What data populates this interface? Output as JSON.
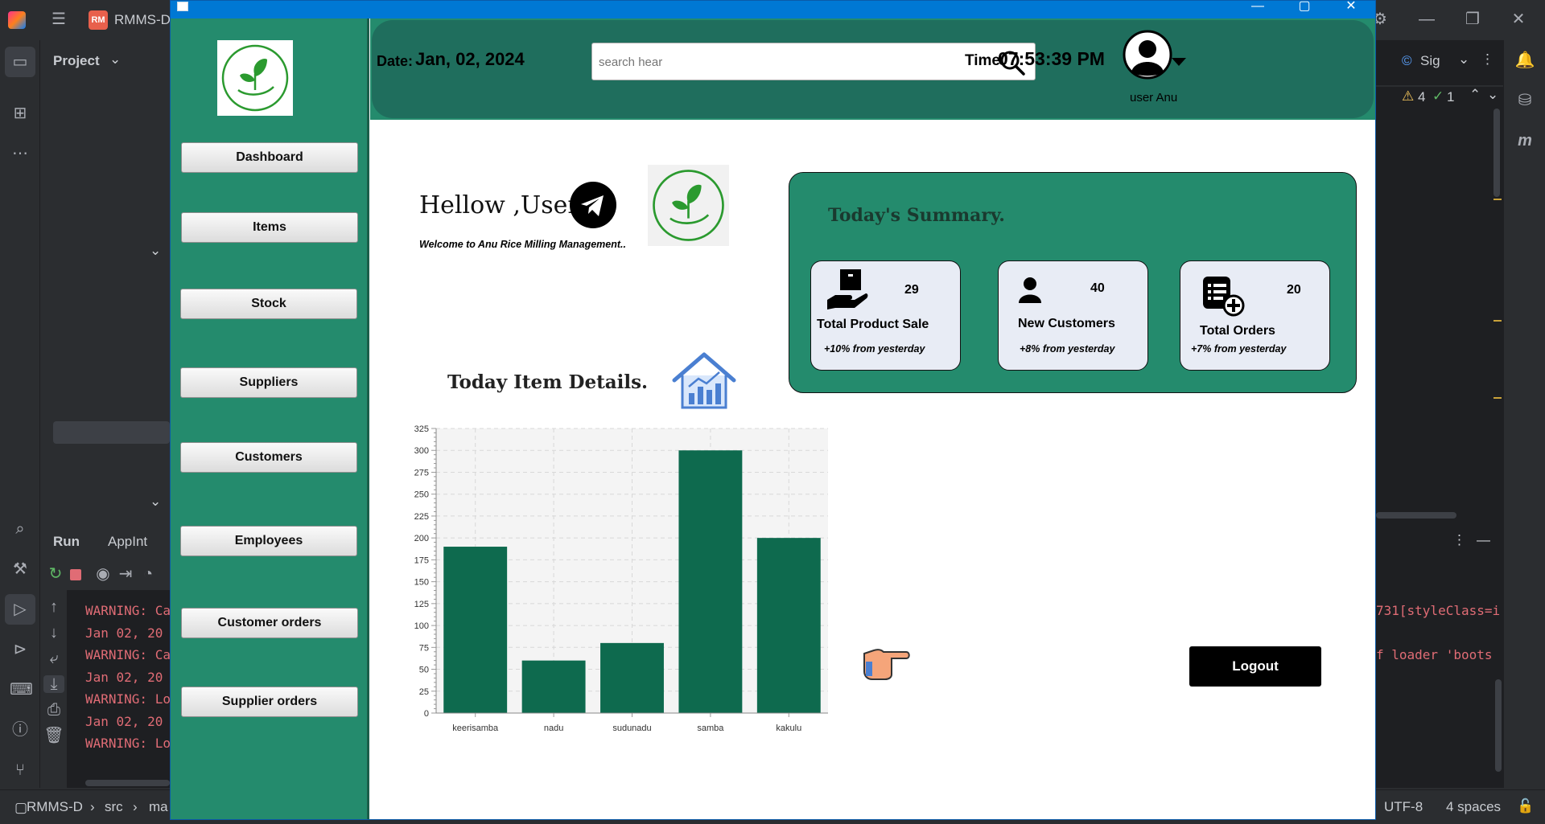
{
  "ide": {
    "project_tab": "RMMS-D",
    "project_label": "Project",
    "run_label": "Run",
    "app_tab": "AppInt",
    "signin": "Sig",
    "warnings": "4",
    "checks": "1",
    "console_left": [
      "WARNING: Ca",
      "Jan 02, 20",
      "WARNING: Ca",
      "Jan 02, 20",
      "WARNING: Lo",
      "Jan 02, 20",
      "WARNING: Lo"
    ],
    "console_right": [
      "731[styleClass=i",
      "f loader 'boots"
    ],
    "breadcrumb": [
      "RMMS-D",
      "src",
      "ma"
    ],
    "encoding": "UTF-8",
    "indent": "4 spaces"
  },
  "header": {
    "date_label": "Date:",
    "date_value": "Jan, 02, 2024",
    "search_placeholder": "search hear",
    "time_label": "Time",
    "time_value": "07:53:39 PM",
    "user_label": "user Anu"
  },
  "sidebar": {
    "items": [
      {
        "label": "Dashboard"
      },
      {
        "label": "Items"
      },
      {
        "label": "Stock"
      },
      {
        "label": "Suppliers"
      },
      {
        "label": "Customers"
      },
      {
        "label": "Employees"
      },
      {
        "label": "Customer orders"
      },
      {
        "label": "Supplier orders"
      }
    ]
  },
  "greeting": {
    "title": "Hellow ,User",
    "subtitle": "Welcome to Anu Rice Milling Management.."
  },
  "summary": {
    "title": "Today's Summary.",
    "cards": [
      {
        "value": "29",
        "label": "Total Product Sale",
        "sub": "+10% from yesterday",
        "icon": "product-sale-icon"
      },
      {
        "value": "40",
        "label": "New Customers",
        "sub": "+8% from yesterday",
        "icon": "customer-icon"
      },
      {
        "value": "20",
        "label": "Total Orders",
        "sub": "+7% from yesterday",
        "icon": "orders-icon"
      }
    ]
  },
  "item_details": {
    "title": "Today Item Details."
  },
  "logout_label": "Logout",
  "colors": {
    "sidebar": "#248b6d",
    "header": "#1f6e5d",
    "bar": "#0e6a4e",
    "titlebar": "#0078d4"
  },
  "chart_data": {
    "type": "bar",
    "categories": [
      "keerisamba",
      "nadu",
      "sudunadu",
      "samba",
      "kakulu"
    ],
    "values": [
      190,
      60,
      80,
      300,
      200
    ],
    "ylim": [
      0,
      325
    ],
    "yticks": [
      0,
      25,
      50,
      75,
      100,
      125,
      150,
      175,
      200,
      225,
      250,
      275,
      300,
      325
    ],
    "grid": true,
    "xlabel": "",
    "ylabel": ""
  }
}
